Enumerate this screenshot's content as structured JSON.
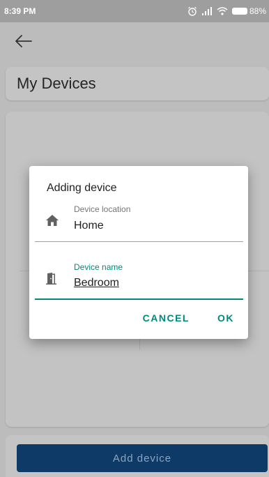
{
  "status_bar": {
    "time": "8:39 PM",
    "battery_pct": "88%"
  },
  "header": {
    "title": "My Devices"
  },
  "dialog": {
    "title": "Adding device",
    "location": {
      "label": "Device location",
      "value": "Home",
      "icon": "home-icon"
    },
    "name": {
      "label": "Device name",
      "value": "Bedroom",
      "icon": "door-icon"
    },
    "cancel_label": "CANCEL",
    "ok_label": "OK"
  },
  "footer": {
    "add_device_label": "Add device"
  },
  "colors": {
    "accent": "#00897b",
    "primary_button": "#0d3a66"
  }
}
